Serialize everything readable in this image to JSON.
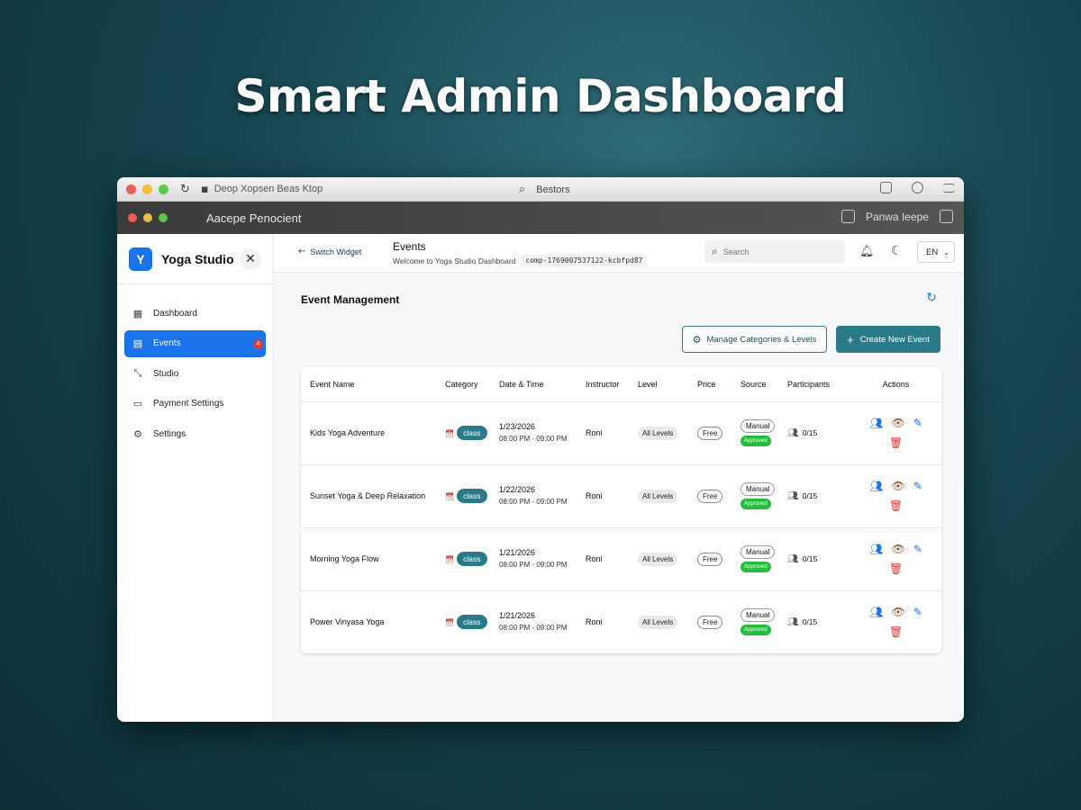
{
  "hero_title": "Smart Admin Dashboard",
  "browser": {
    "address_text": "Deop Xopsen Beas Ktop",
    "center_text": "Bestors"
  },
  "app_bar": {
    "title": "Aacepe Penocient",
    "right_text": "Panwa Ieepe"
  },
  "sidebar": {
    "logo_letter": "Y",
    "brand": "Yoga Studio",
    "items": [
      {
        "label": "Dashboard",
        "icon": "dashboard-icon"
      },
      {
        "label": "Events",
        "icon": "calendar-icon",
        "badge": "4",
        "active": true
      },
      {
        "label": "Studio",
        "icon": "expand-icon"
      },
      {
        "label": "Payment Settings",
        "icon": "credit-card-icon"
      },
      {
        "label": "Settings",
        "icon": "gear-icon"
      }
    ]
  },
  "topbar": {
    "back_label": "Switch Widget",
    "title": "Events",
    "subtitle": "Welcome to Yoga Studio Dashboard",
    "component_id": "comp-1769007537122-kcbfpd87",
    "search_placeholder": "Search",
    "language": "EN"
  },
  "section": {
    "title": "Event Management",
    "manage_button": "Manage Categories & Levels",
    "create_button": "Create New Event"
  },
  "table": {
    "headers": [
      "Event Name",
      "Category",
      "Date & Time",
      "Instructor",
      "Level",
      "Price",
      "Source",
      "Participants",
      "Actions"
    ],
    "rows": [
      {
        "name": "Kids Yoga Adventure",
        "category": "class",
        "date": "1/23/2026",
        "time": "08:00 PM - 09:00 PM",
        "instructor": "Roni",
        "level": "All Levels",
        "price": "Free",
        "source": "Manual",
        "status": "Approved",
        "participants": "0/15"
      },
      {
        "name": "Sunset Yoga & Deep Relaxation",
        "category": "class",
        "date": "1/22/2026",
        "time": "08:00 PM - 09:00 PM",
        "instructor": "Roni",
        "level": "All Levels",
        "price": "Free",
        "source": "Manual",
        "status": "Approved",
        "participants": "0/15"
      },
      {
        "name": "Morning Yoga Flow",
        "category": "class",
        "date": "1/21/2026",
        "time": "08:00 PM - 09:00 PM",
        "instructor": "Roni",
        "level": "All Levels",
        "price": "Free",
        "source": "Manual",
        "status": "Approved",
        "participants": "0/15"
      },
      {
        "name": "Power Vinyasa Yoga",
        "category": "class",
        "date": "1/21/2026",
        "time": "08:00 PM - 09:00 PM",
        "instructor": "Roni",
        "level": "All Levels",
        "price": "Free",
        "source": "Manual",
        "status": "Approved",
        "participants": "0/15"
      }
    ]
  },
  "colors": {
    "accent": "#1a73e8",
    "teal": "#2b7a8a",
    "approved": "#1fbf3a",
    "danger": "#e53935"
  }
}
